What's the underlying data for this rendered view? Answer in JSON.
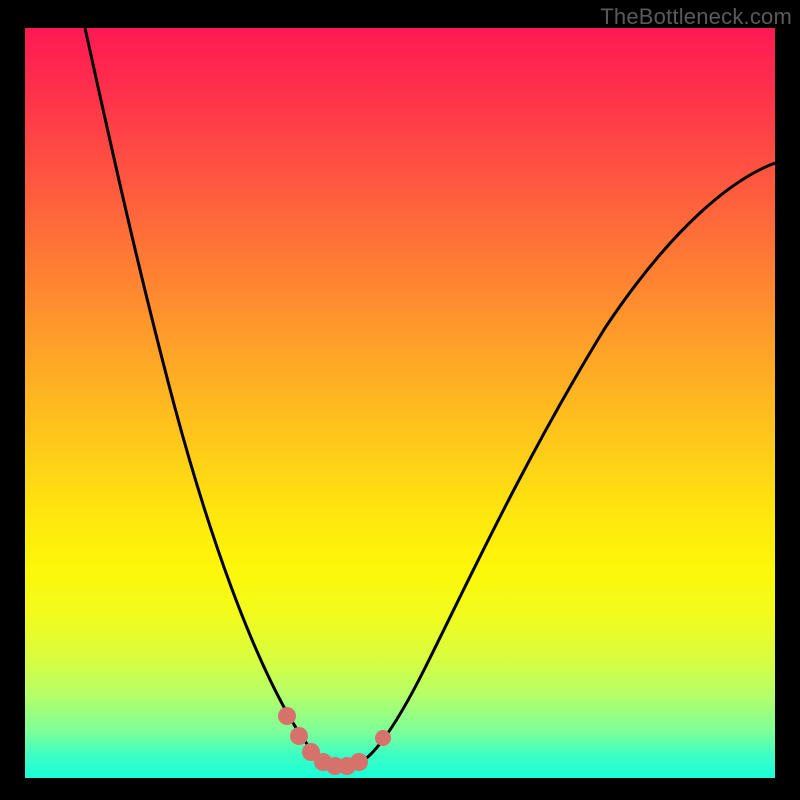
{
  "watermark": "TheBottleneck.com",
  "chart_data": {
    "type": "line",
    "title": "",
    "xlabel": "",
    "ylabel": "",
    "xlim": [
      0,
      100
    ],
    "ylim": [
      0,
      100
    ],
    "series": [
      {
        "name": "bottleneck-curve",
        "x": [
          8,
          12,
          16,
          20,
          24,
          28,
          31,
          34,
          36,
          38,
          40,
          42,
          44,
          46,
          50,
          55,
          62,
          70,
          80,
          90,
          100
        ],
        "values": [
          100,
          84,
          68,
          53,
          40,
          28,
          18,
          10,
          5,
          2,
          1,
          1,
          2,
          4,
          10,
          18,
          30,
          44,
          60,
          72,
          82
        ]
      }
    ],
    "highlight": {
      "name": "bottom-highlight",
      "x": [
        34,
        36,
        38,
        40,
        42,
        44,
        46
      ],
      "values": [
        10,
        5,
        2,
        1,
        1,
        2,
        4
      ],
      "color": "#d6716c"
    }
  }
}
